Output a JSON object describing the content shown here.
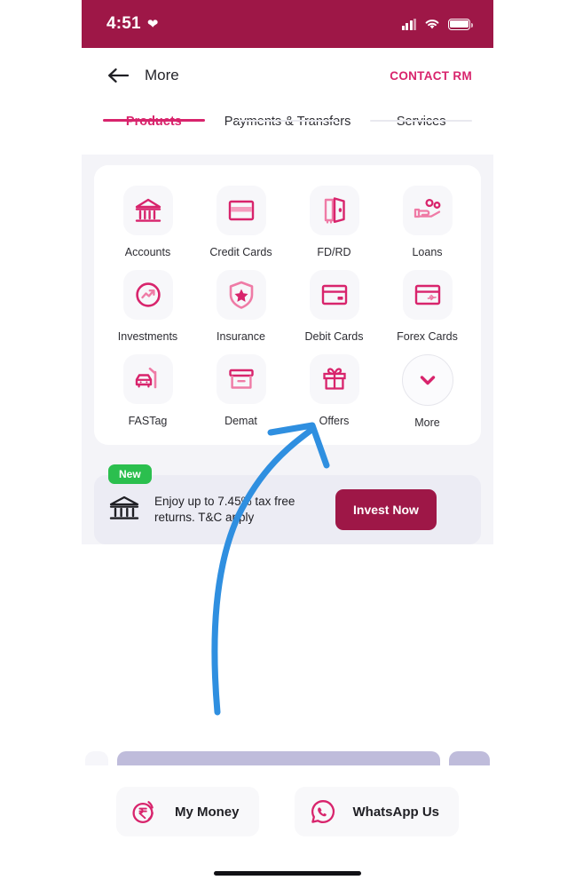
{
  "status_bar": {
    "time": "4:51",
    "heart_icon": "heart-icon",
    "signal_icon": "signal-bars-icon",
    "wifi_icon": "wifi-icon",
    "battery_icon": "battery-icon"
  },
  "nav": {
    "back_icon": "back-arrow-icon",
    "title": "More",
    "contact_rm": "CONTACT RM"
  },
  "tabs": [
    {
      "label": "Products",
      "active": true
    },
    {
      "label": "Payments & Transfers",
      "active": false
    },
    {
      "label": "Services",
      "active": false
    }
  ],
  "grid": {
    "rows": [
      [
        {
          "label": "Accounts",
          "icon": "bank-building-icon"
        },
        {
          "label": "Credit Cards",
          "icon": "credit-card-icon"
        },
        {
          "label": "FD/RD",
          "icon": "vault-door-icon"
        },
        {
          "label": "Loans",
          "icon": "hand-coins-icon"
        }
      ],
      [
        {
          "label": "Investments",
          "icon": "trend-up-circle-icon"
        },
        {
          "label": "Insurance",
          "icon": "shield-star-icon"
        },
        {
          "label": "Debit Cards",
          "icon": "debit-card-icon"
        },
        {
          "label": "Forex Cards",
          "icon": "forex-card-plane-icon"
        }
      ],
      [
        {
          "label": "FASTag",
          "icon": "car-toll-barrier-icon"
        },
        {
          "label": "Demat",
          "icon": "archive-box-icon"
        },
        {
          "label": "Offers",
          "icon": "gift-icon"
        },
        {
          "label": "More",
          "icon": "chevron-down-icon"
        }
      ]
    ]
  },
  "promo": {
    "badge": "New",
    "icon": "bank-building-icon",
    "text": "Enjoy up to 7.45% tax free returns. T&C apply",
    "button": "Invest Now"
  },
  "bottom_bar": [
    {
      "label": "My Money",
      "icon": "rupee-coins-icon"
    },
    {
      "label": "WhatsApp Us",
      "icon": "whatsapp-icon"
    }
  ],
  "colors": {
    "brand_maroon": "#9e1747",
    "accent_pink": "#d8246c",
    "icon_pink_light": "#ef7ba6",
    "badge_green": "#2bbf4e",
    "page_bg": "#f4f4f8",
    "annotation_blue": "#2f8fe0"
  }
}
